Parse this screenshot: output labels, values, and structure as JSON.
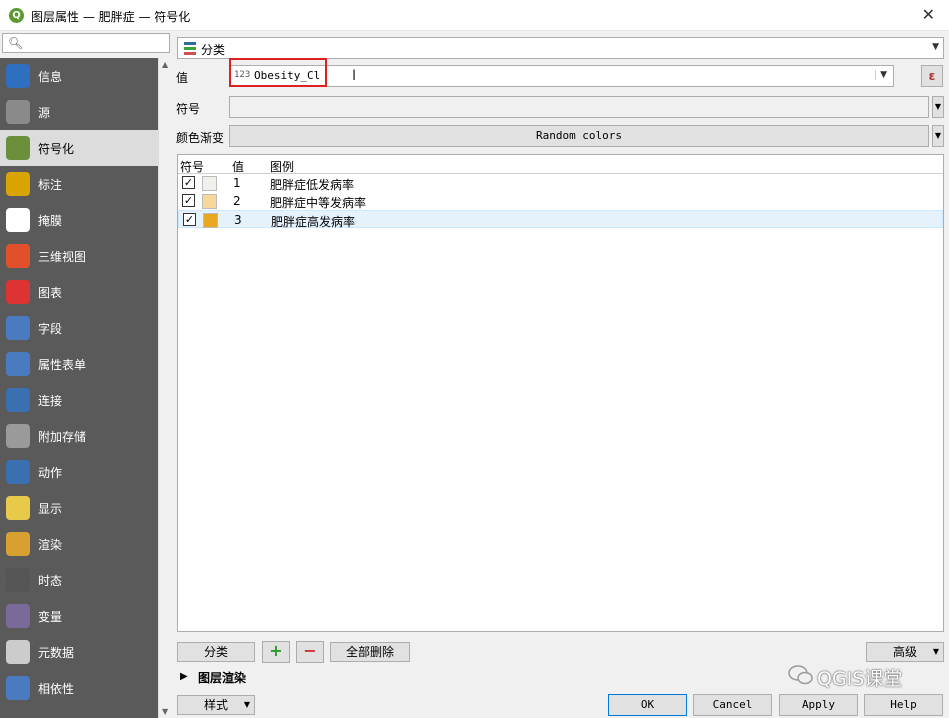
{
  "window": {
    "title": "图层属性 — 肥胖症 — 符号化",
    "app_icon": "qgis-icon",
    "close_label": "✕"
  },
  "sidebar": {
    "search_placeholder": "",
    "items": [
      {
        "label": "信息",
        "icon": "info-icon",
        "color": "#2f6fc0"
      },
      {
        "label": "源",
        "icon": "source-icon",
        "color": "#8a8a8a"
      },
      {
        "label": "符号化",
        "icon": "symbology-icon",
        "color": "#6b8f3a",
        "active": true
      },
      {
        "label": "标注",
        "icon": "labels-icon",
        "color": "#d9a400"
      },
      {
        "label": "掩膜",
        "icon": "mask-icon",
        "color": "#ffffff"
      },
      {
        "label": "三维视图",
        "icon": "3d-view-icon",
        "color": "#e0502a"
      },
      {
        "label": "图表",
        "icon": "diagrams-icon",
        "color": "#d33"
      },
      {
        "label": "字段",
        "icon": "fields-icon",
        "color": "#4a7ac0"
      },
      {
        "label": "属性表单",
        "icon": "attributes-form-icon",
        "color": "#4a7ac0"
      },
      {
        "label": "连接",
        "icon": "joins-icon",
        "color": "#3a6fb0"
      },
      {
        "label": "附加存储",
        "icon": "auxiliary-storage-icon",
        "color": "#9a9a9a"
      },
      {
        "label": "动作",
        "icon": "actions-icon",
        "color": "#3a6fb0"
      },
      {
        "label": "显示",
        "icon": "display-icon",
        "color": "#e8c94a"
      },
      {
        "label": "渲染",
        "icon": "rendering-icon",
        "color": "#d8a030"
      },
      {
        "label": "时态",
        "icon": "temporal-icon",
        "color": "#555555"
      },
      {
        "label": "变量",
        "icon": "variables-icon",
        "color": "#7a6a9a"
      },
      {
        "label": "元数据",
        "icon": "metadata-icon",
        "color": "#cccccc"
      },
      {
        "label": "相依性",
        "icon": "dependencies-icon",
        "color": "#4a7ac0"
      }
    ]
  },
  "renderer": {
    "label": "分类",
    "icon": "categorized-icon"
  },
  "form": {
    "value_label": "值",
    "value_field": "Obesity_Cl",
    "value_field_type": "123",
    "expression_label": "ε",
    "symbol_label": "符号",
    "color_ramp_label": "颜色渐变",
    "color_ramp_value": "Random colors"
  },
  "table": {
    "headers": [
      "符号",
      "值",
      "图例"
    ],
    "rows": [
      {
        "checked": "✓",
        "color": "#f2f0ec",
        "value": "1",
        "legend": "肥胖症低发病率"
      },
      {
        "checked": "✓",
        "color": "#f7d89a",
        "value": "2",
        "legend": "肥胖症中等发病率"
      },
      {
        "checked": "✓",
        "color": "#e8a820",
        "value": "3",
        "legend": "肥胖症高发病率"
      }
    ]
  },
  "actions": {
    "classify": "分类",
    "add": "+",
    "remove": "−",
    "delete_all": "全部删除",
    "advanced": "高级"
  },
  "layer_rendering": "图层渲染",
  "footer": {
    "style": "样式",
    "ok": "OK",
    "cancel": "Cancel",
    "apply": "Apply",
    "help": "Help"
  },
  "watermark": "QGIS课堂"
}
